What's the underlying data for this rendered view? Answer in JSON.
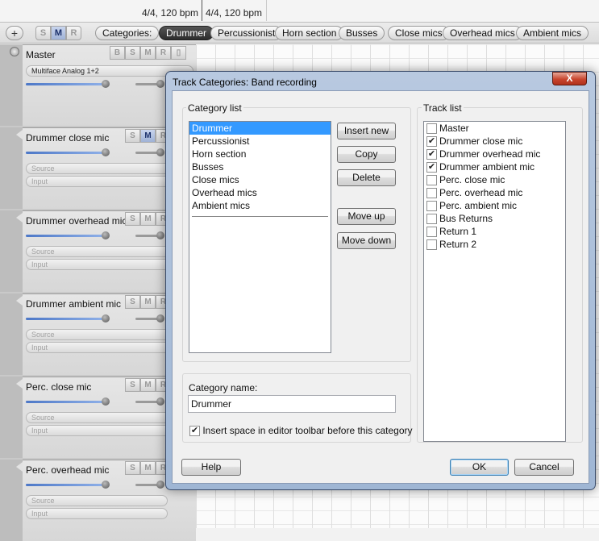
{
  "ruler": {
    "tempo_left": "4/4, 120 bpm",
    "tempo_right": "4/4, 120 bpm"
  },
  "toolbar": {
    "add_symbol": "+",
    "solo_label": "S",
    "mute_label": "M",
    "record_label": "R",
    "categories_label": "Categories:",
    "category_tabs": [
      "Drummer",
      "Percussionist",
      "Horn section",
      "Busses",
      "Close mics",
      "Overhead mics",
      "Ambient mics"
    ],
    "active_category": "Drummer"
  },
  "tracks": [
    {
      "name": "Master",
      "buttons": [
        "B",
        "S",
        "M",
        "R"
      ],
      "output": "Multiface Analog 1+2",
      "is_master": true
    },
    {
      "name": "Drummer close mic",
      "buttons": [
        "S",
        "M",
        "R"
      ],
      "mute_on": true,
      "source": "Source",
      "input": "Input"
    },
    {
      "name": "Drummer overhead mic",
      "buttons": [
        "S",
        "M",
        "R"
      ],
      "source": "Source",
      "input": "Input"
    },
    {
      "name": "Drummer ambient mic",
      "buttons": [
        "S",
        "M",
        "R"
      ],
      "source": "Source",
      "input": "Input"
    },
    {
      "name": "Perc. close mic",
      "buttons": [
        "S",
        "M",
        "R"
      ],
      "source": "Source",
      "input": "Input"
    },
    {
      "name": "Perc. overhead mic",
      "buttons": [
        "S",
        "M",
        "R"
      ],
      "source": "Source",
      "input": "Input"
    }
  ],
  "dialog": {
    "title": "Track Categories: Band recording",
    "close_symbol": "X",
    "category_list_label": "Category list",
    "category_list": [
      "Drummer",
      "Percussionist",
      "Horn section",
      "Busses",
      "Close mics",
      "Overhead mics",
      "Ambient mics"
    ],
    "selected_category_index": 0,
    "buttons": {
      "insert_new": "Insert new",
      "copy": "Copy",
      "delete": "Delete",
      "move_up": "Move up",
      "move_down": "Move down",
      "help": "Help",
      "ok": "OK",
      "cancel": "Cancel"
    },
    "category_name_label": "Category name:",
    "category_name_value": "Drummer",
    "insert_space_label": "Insert space in editor toolbar before this category",
    "insert_space_checked": true,
    "track_list_label": "Track list",
    "track_list": [
      {
        "name": "Master",
        "checked": false
      },
      {
        "name": "Drummer close mic",
        "checked": true
      },
      {
        "name": "Drummer overhead mic",
        "checked": true
      },
      {
        "name": "Drummer ambient mic",
        "checked": true
      },
      {
        "name": "Perc. close mic",
        "checked": false
      },
      {
        "name": "Perc. overhead mic",
        "checked": false
      },
      {
        "name": "Perc. ambient mic",
        "checked": false
      },
      {
        "name": "Bus Returns",
        "checked": false
      },
      {
        "name": "Return 1",
        "checked": false
      },
      {
        "name": "Return 2",
        "checked": false
      }
    ]
  }
}
